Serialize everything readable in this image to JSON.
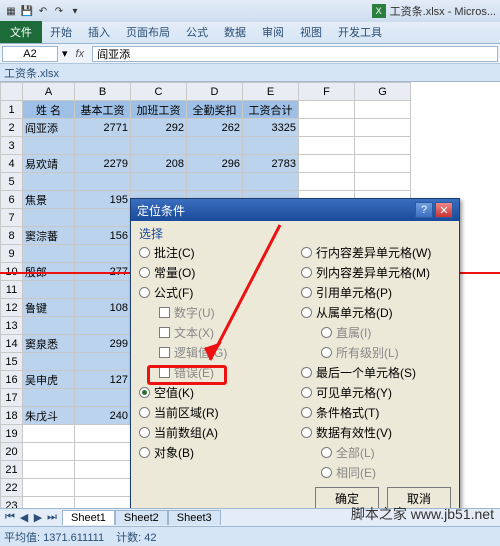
{
  "window": {
    "title": "工资条.xlsx - Micros..."
  },
  "ribbon": {
    "file": "文件",
    "tabs": [
      "开始",
      "插入",
      "页面布局",
      "公式",
      "数据",
      "审阅",
      "视图",
      "开发工具"
    ]
  },
  "fx": {
    "namebox": "A2",
    "label": "fx",
    "value": "阎亚添"
  },
  "workbook": "工资条.xlsx",
  "cols": [
    "A",
    "B",
    "C",
    "D",
    "E",
    "F",
    "G"
  ],
  "headers": [
    "姓 名",
    "基本工资",
    "加班工资",
    "全勤奖扣",
    "工资合计"
  ],
  "rows": [
    {
      "r": 2,
      "a": "阎亚添",
      "b": "2771",
      "c": "292",
      "d": "262",
      "e": "3325"
    },
    {
      "r": 3,
      "a": "",
      "b": "",
      "c": "",
      "d": "",
      "e": ""
    },
    {
      "r": 4,
      "a": "易欢靖",
      "b": "2279",
      "c": "208",
      "d": "296",
      "e": "2783"
    },
    {
      "r": 5,
      "a": "",
      "b": "",
      "c": "",
      "d": "",
      "e": ""
    },
    {
      "r": 6,
      "a": "焦景",
      "b": "195",
      "c": "",
      "d": "",
      "e": ""
    },
    {
      "r": 7,
      "a": "",
      "b": "",
      "c": "",
      "d": "",
      "e": ""
    },
    {
      "r": 8,
      "a": "窦淙蕃",
      "b": "156",
      "c": "",
      "d": "",
      "e": ""
    },
    {
      "r": 9,
      "a": "",
      "b": "",
      "c": "",
      "d": "",
      "e": ""
    },
    {
      "r": 10,
      "a": "殷郎",
      "b": "277",
      "c": "",
      "d": "",
      "e": ""
    },
    {
      "r": 11,
      "a": "",
      "b": "",
      "c": "",
      "d": "",
      "e": ""
    },
    {
      "r": 12,
      "a": "鲁键",
      "b": "108",
      "c": "",
      "d": "",
      "e": ""
    },
    {
      "r": 13,
      "a": "",
      "b": "",
      "c": "",
      "d": "",
      "e": ""
    },
    {
      "r": 14,
      "a": "窦泉悉",
      "b": "299",
      "c": "",
      "d": "",
      "e": ""
    },
    {
      "r": 15,
      "a": "",
      "b": "",
      "c": "",
      "d": "",
      "e": ""
    },
    {
      "r": 16,
      "a": "吴申虎",
      "b": "127",
      "c": "",
      "d": "",
      "e": ""
    },
    {
      "r": 17,
      "a": "",
      "b": "",
      "c": "",
      "d": "",
      "e": ""
    },
    {
      "r": 18,
      "a": "朱戊斗",
      "b": "240",
      "c": "",
      "d": "",
      "e": ""
    }
  ],
  "dialog": {
    "title": "定位条件",
    "section": "选择",
    "left": [
      {
        "t": "radio",
        "label": "批注(C)"
      },
      {
        "t": "radio",
        "label": "常量(O)"
      },
      {
        "t": "radio",
        "label": "公式(F)"
      },
      {
        "t": "check",
        "label": "数字(U)",
        "dis": true,
        "sub": true
      },
      {
        "t": "check",
        "label": "文本(X)",
        "dis": true,
        "sub": true
      },
      {
        "t": "check",
        "label": "逻辑值(G)",
        "dis": true,
        "sub": true
      },
      {
        "t": "check",
        "label": "错误(E)",
        "dis": true,
        "sub": true
      },
      {
        "t": "radio",
        "label": "空值(K)",
        "sel": true
      },
      {
        "t": "radio",
        "label": "当前区域(R)"
      },
      {
        "t": "radio",
        "label": "当前数组(A)"
      },
      {
        "t": "radio",
        "label": "对象(B)"
      }
    ],
    "right": [
      {
        "t": "radio",
        "label": "行内容差异单元格(W)"
      },
      {
        "t": "radio",
        "label": "列内容差异单元格(M)"
      },
      {
        "t": "radio",
        "label": "引用单元格(P)"
      },
      {
        "t": "radio",
        "label": "从属单元格(D)"
      },
      {
        "t": "radio",
        "label": "直属(I)",
        "dis": true,
        "sub": true
      },
      {
        "t": "radio",
        "label": "所有级别(L)",
        "dis": true,
        "sub": true
      },
      {
        "t": "radio",
        "label": "最后一个单元格(S)"
      },
      {
        "t": "radio",
        "label": "可见单元格(Y)"
      },
      {
        "t": "radio",
        "label": "条件格式(T)"
      },
      {
        "t": "radio",
        "label": "数据有效性(V)"
      },
      {
        "t": "radio",
        "label": "全部(L)",
        "dis": true,
        "sub": true
      },
      {
        "t": "radio",
        "label": "相同(E)",
        "dis": true,
        "sub": true
      }
    ],
    "ok": "确定",
    "cancel": "取消"
  },
  "sheets": [
    "Sheet1",
    "Sheet2",
    "Sheet3"
  ],
  "status": {
    "avg": "平均值: 1371.611111",
    "count": "计数: 42"
  },
  "watermark": "脚本之家 www.jb51.net"
}
